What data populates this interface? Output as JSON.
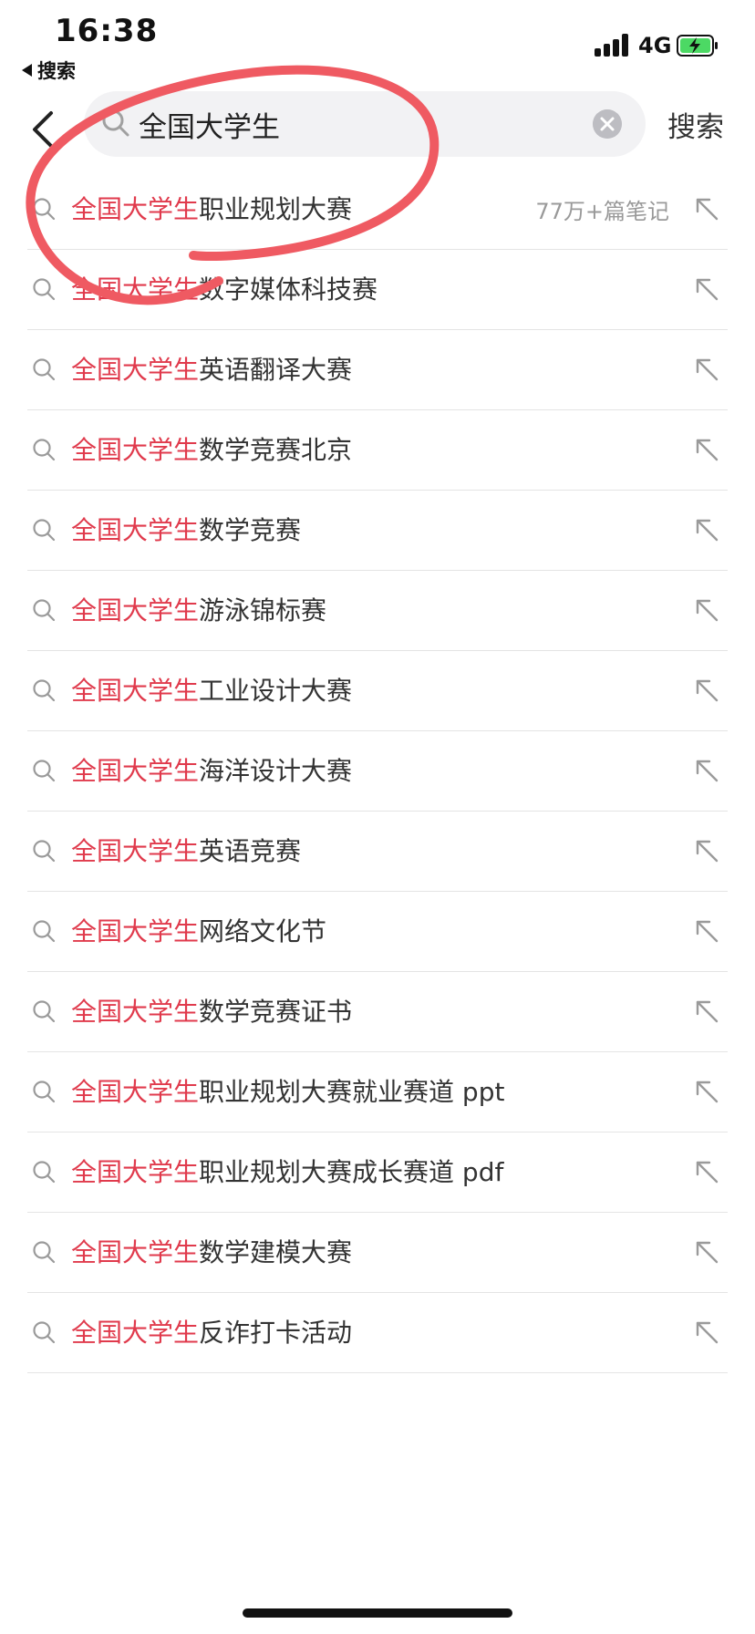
{
  "status_bar": {
    "time": "16:38",
    "back_label": "搜索",
    "network": "4G"
  },
  "search": {
    "query": "全国大学生",
    "button_label": "搜索"
  },
  "suggestions": [
    {
      "highlight": "全国大学生",
      "rest": "职业规划大赛",
      "count": "77万+篇笔记"
    },
    {
      "highlight": "全国大学生",
      "rest": "数字媒体科技赛"
    },
    {
      "highlight": "全国大学生",
      "rest": "英语翻译大赛"
    },
    {
      "highlight": "全国大学生",
      "rest": "数学竞赛北京"
    },
    {
      "highlight": "全国大学生",
      "rest": "数学竞赛"
    },
    {
      "highlight": "全国大学生",
      "rest": "游泳锦标赛"
    },
    {
      "highlight": "全国大学生",
      "rest": "工业设计大赛"
    },
    {
      "highlight": "全国大学生",
      "rest": "海洋设计大赛"
    },
    {
      "highlight": "全国大学生",
      "rest": "英语竞赛"
    },
    {
      "highlight": "全国大学生",
      "rest": "网络文化节"
    },
    {
      "highlight": "全国大学生",
      "rest": "数学竞赛证书"
    },
    {
      "highlight": "全国大学生",
      "rest": "职业规划大赛就业赛道 ppt"
    },
    {
      "highlight": "全国大学生",
      "rest": "职业规划大赛成长赛道 pdf"
    },
    {
      "highlight": "全国大学生",
      "rest": "数学建模大赛"
    },
    {
      "highlight": "全国大学生",
      "rest": "反诈打卡活动"
    }
  ],
  "colors": {
    "highlight": "#e03a4c",
    "annotation": "#ef5a62",
    "battery": "#4cd964"
  }
}
